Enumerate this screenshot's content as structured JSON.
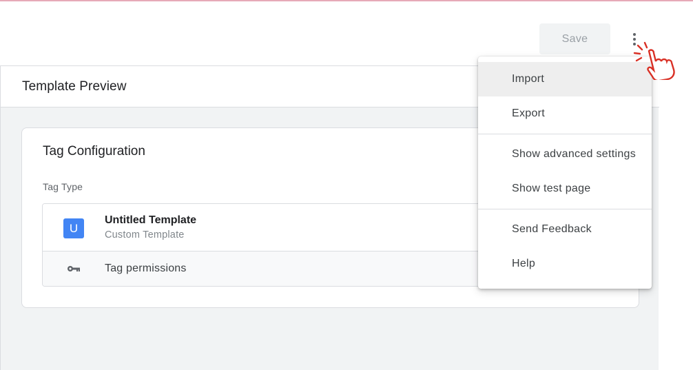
{
  "toolbar": {
    "save_label": "Save",
    "more_icon": "more-vert-icon",
    "cursor_icon": "pointer-hand-icon"
  },
  "preview": {
    "title": "Template Preview",
    "card": {
      "title": "Tag Configuration",
      "tag_type_label": "Tag Type",
      "template": {
        "badge": "U",
        "name": "Untitled Template",
        "subtitle": "Custom Template"
      },
      "permissions": {
        "icon": "key-icon",
        "label": "Tag permissions"
      }
    }
  },
  "menu": {
    "groups": [
      [
        "Import",
        "Export"
      ],
      [
        "Show advanced settings",
        "Show test page"
      ],
      [
        "Send Feedback",
        "Help"
      ]
    ],
    "items": {
      "import": "Import",
      "export": "Export",
      "advanced": "Show advanced settings",
      "test_page": "Show test page",
      "feedback": "Send Feedback",
      "help": "Help"
    },
    "highlighted": "Import"
  },
  "colors": {
    "badge_blue": "#4285f4",
    "cursor_red": "#d93025",
    "panel_bg": "#f1f3f4"
  }
}
